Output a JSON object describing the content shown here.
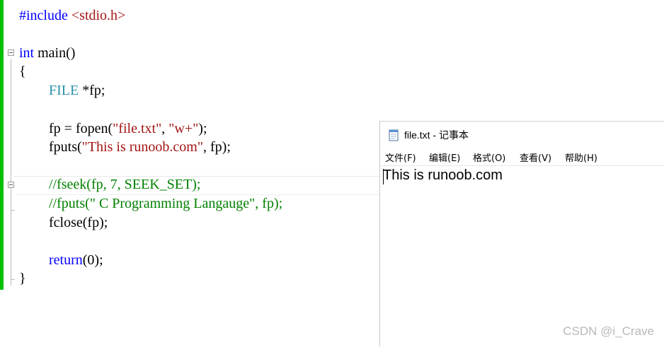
{
  "editor": {
    "lines": {
      "l1_pp": "#include",
      "l1_inc": " <stdio.h>",
      "l3_kw": "int",
      "l3_rest": " main()",
      "l4": "{",
      "l5_ty": "FILE",
      "l5_rest": " *fp;",
      "l7_a": "fp = fopen(",
      "l7_s1": "\"file.txt\"",
      "l7_b": ", ",
      "l7_s2": "\"w+\"",
      "l7_c": ");",
      "l8_a": "fputs(",
      "l8_s": "\"This is runoob.com\"",
      "l8_b": ", fp);",
      "l10": "//fseek(fp, 7, SEEK_SET);",
      "l11": "//fputs(\" C Programming Langauge\", fp);",
      "l12": "fclose(fp);",
      "l14_kw": "return",
      "l14_rest": "(0);",
      "l15": "}"
    },
    "colors": {
      "keyword": "#0000ff",
      "type": "#2b91af",
      "string": "#a31515",
      "comment": "#008000",
      "change_bar": "#00c000"
    }
  },
  "notepad": {
    "title": "file.txt - 记事本",
    "icon": "notepad-icon",
    "menu": {
      "file": "文件(F)",
      "edit": "编辑(E)",
      "format": "格式(O)",
      "view": "查看(V)",
      "help": "帮助(H)"
    },
    "content": "This is runoob.com"
  },
  "watermark": "CSDN @i_Crave"
}
